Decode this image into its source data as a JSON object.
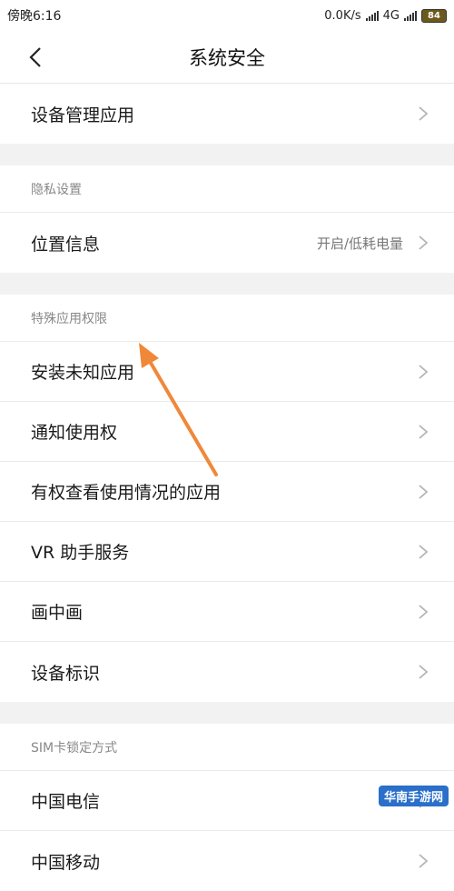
{
  "status": {
    "time": "傍晚6:16",
    "net_speed": "0.0K/s",
    "network": "4G",
    "battery": "84"
  },
  "header": {
    "title": "系统安全"
  },
  "groups": [
    {
      "items": [
        {
          "label": "设备管理应用"
        }
      ]
    },
    {
      "header": "隐私设置",
      "items": [
        {
          "label": "位置信息",
          "value": "开启/低耗电量"
        }
      ]
    },
    {
      "header": "特殊应用权限",
      "items": [
        {
          "label": "安装未知应用"
        },
        {
          "label": "通知使用权"
        },
        {
          "label": "有权查看使用情况的应用"
        },
        {
          "label": "VR 助手服务"
        },
        {
          "label": "画中画"
        },
        {
          "label": "设备标识"
        }
      ]
    },
    {
      "header": "SIM卡锁定方式",
      "items": [
        {
          "label": "中国电信"
        },
        {
          "label": "中国移动"
        }
      ]
    }
  ],
  "annotation": {
    "arrow_color": "#f0883a"
  },
  "watermark": "华南手游网"
}
